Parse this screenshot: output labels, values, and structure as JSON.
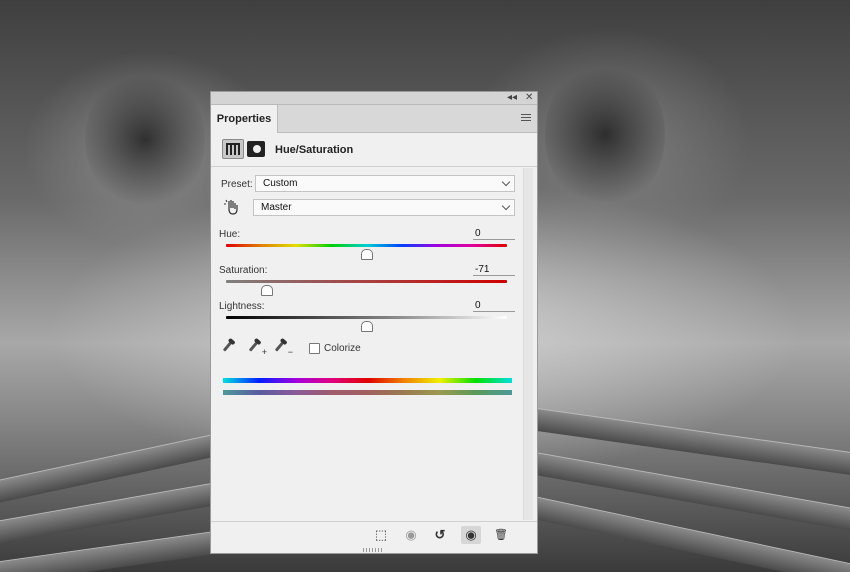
{
  "panel": {
    "tab_label": "Properties",
    "adjustment_title": "Hue/Saturation",
    "collapse_glyph": "◂◂",
    "close_glyph": "✕",
    "preset": {
      "label": "Preset:",
      "value": "Custom"
    },
    "channel": {
      "value": "Master"
    },
    "hue": {
      "label": "Hue:",
      "value": "0",
      "position": 0.5
    },
    "saturation": {
      "label": "Saturation:",
      "value": "-71",
      "position": 0.145
    },
    "lightness": {
      "label": "Lightness:",
      "value": "0",
      "position": 0.5
    },
    "colorize": {
      "label": "Colorize",
      "checked": false
    },
    "footer": {
      "clip_glyph": "⬚",
      "view_prev_glyph": "◉",
      "reset_glyph": "↺",
      "visibility_glyph": "◉",
      "delete_glyph": "🗑"
    }
  },
  "icons": [
    "panel-collapse-icon",
    "panel-close-icon",
    "panel-menu-icon",
    "adjustment-layer-icon",
    "layer-mask-icon",
    "targeted-adjustment-hand-icon",
    "eyedropper-icon",
    "eyedropper-plus-icon",
    "eyedropper-minus-icon",
    "clip-to-layer-icon",
    "view-previous-state-icon",
    "reset-icon",
    "visibility-eye-icon",
    "trash-icon"
  ]
}
